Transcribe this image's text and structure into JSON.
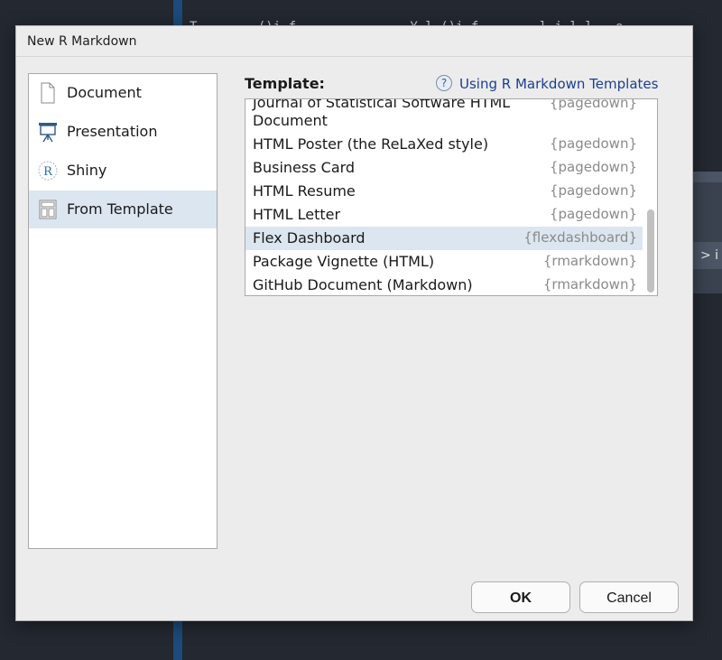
{
  "background": {
    "code_line": "T--------()i-f---------------Y-l-()i-f--------l-i-l-l-, o",
    "panel_row": "> i"
  },
  "dialog": {
    "title": "New R Markdown",
    "types": [
      {
        "label": "Document",
        "icon": "document-icon"
      },
      {
        "label": "Presentation",
        "icon": "presentation-icon"
      },
      {
        "label": "Shiny",
        "icon": "shiny-icon"
      },
      {
        "label": "From Template",
        "icon": "template-icon",
        "selected": true
      }
    ],
    "template_header": "Template:",
    "help_link": {
      "icon": "question-icon",
      "label": "Using R Markdown Templates"
    },
    "templates": [
      {
        "name": "Journal of Statistical Software HTML Document",
        "package": "{pagedown}"
      },
      {
        "name": "HTML Poster (the ReLaXed style)",
        "package": "{pagedown}"
      },
      {
        "name": "Business Card",
        "package": "{pagedown}"
      },
      {
        "name": "HTML Resume",
        "package": "{pagedown}"
      },
      {
        "name": "HTML Letter",
        "package": "{pagedown}"
      },
      {
        "name": "Flex Dashboard",
        "package": "{flexdashboard}",
        "selected": true
      },
      {
        "name": "Package Vignette (HTML)",
        "package": "{rmarkdown}"
      },
      {
        "name": "GitHub Document (Markdown)",
        "package": "{rmarkdown}"
      }
    ],
    "ok_label": "OK",
    "cancel_label": "Cancel"
  },
  "colors": {
    "selection": "#dce6f0",
    "link": "#1b3f8f",
    "package_text": "#8a8a8a"
  }
}
